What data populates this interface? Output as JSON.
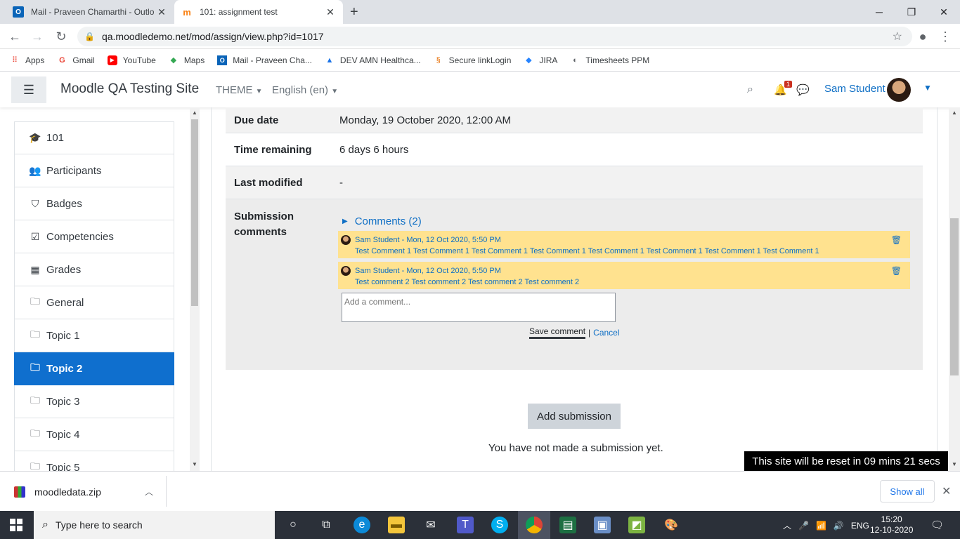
{
  "browser": {
    "tabs": [
      {
        "title": "Mail - Praveen Chamarthi - Outlo",
        "icon": "outlook-icon"
      },
      {
        "title": "101: assignment test",
        "icon": "moodle-icon"
      }
    ],
    "url": "qa.moodledemo.net/mod/assign/view.php?id=1017",
    "bookmarks": [
      {
        "label": "Apps",
        "icon": "apps-icon"
      },
      {
        "label": "Gmail",
        "icon": "google-icon"
      },
      {
        "label": "YouTube",
        "icon": "youtube-icon"
      },
      {
        "label": "Maps",
        "icon": "maps-icon"
      },
      {
        "label": "Mail - Praveen Cha...",
        "icon": "outlook-icon"
      },
      {
        "label": "DEV AMN Healthca...",
        "icon": "dev-icon"
      },
      {
        "label": "Secure linkLogin",
        "icon": "link-icon"
      },
      {
        "label": "JIRA",
        "icon": "jira-icon"
      },
      {
        "label": "Timesheets PPM",
        "icon": "timesheet-icon"
      }
    ]
  },
  "navbar": {
    "site_name": "Moodle QA Testing Site",
    "theme_label": "THEME",
    "language_label": "English (en)",
    "notification_count": "1",
    "user_name": "Sam Student"
  },
  "sidebar": {
    "items": [
      {
        "label": "101",
        "icon": "graduation-cap-icon"
      },
      {
        "label": "Participants",
        "icon": "users-icon"
      },
      {
        "label": "Badges",
        "icon": "shield-icon"
      },
      {
        "label": "Competencies",
        "icon": "check-square-icon"
      },
      {
        "label": "Grades",
        "icon": "table-icon"
      },
      {
        "label": "General",
        "icon": "folder-icon"
      },
      {
        "label": "Topic 1",
        "icon": "folder-icon"
      },
      {
        "label": "Topic 2",
        "icon": "folder-icon",
        "active": true
      },
      {
        "label": "Topic 3",
        "icon": "folder-icon"
      },
      {
        "label": "Topic 4",
        "icon": "folder-icon"
      },
      {
        "label": "Topic 5",
        "icon": "folder-icon"
      }
    ]
  },
  "status": {
    "due_date_label": "Due date",
    "due_date_value": "Monday, 19 October 2020, 12:00 AM",
    "time_remaining_label": "Time remaining",
    "time_remaining_value": "6 days 6 hours",
    "last_modified_label": "Last modified",
    "last_modified_value": "-",
    "submission_comments_label": "Submission comments"
  },
  "comments": {
    "header": "Comments (2)",
    "items": [
      {
        "meta": "Sam Student - Mon, 12 Oct 2020, 5:50 PM",
        "text": "Test Comment 1 Test Comment 1 Test Comment 1 Test Comment 1 Test Comment 1 Test Comment 1 Test Comment 1 Test Comment 1"
      },
      {
        "meta": "Sam Student - Mon, 12 Oct 2020, 5:50 PM",
        "text": "Test comment 2 Test comment 2 Test comment 2 Test comment 2"
      }
    ],
    "placeholder": "Add a comment...",
    "save_label": "Save comment",
    "separator": "|",
    "cancel_label": "Cancel"
  },
  "submission": {
    "button_label": "Add submission",
    "status_text": "You have not made a submission yet."
  },
  "reset_notice": "This site will be reset in 09 mins 21 secs",
  "download": {
    "file_name": "moodledata.zip",
    "show_all_label": "Show all"
  },
  "taskbar": {
    "search_placeholder": "Type here to search",
    "language": "ENG",
    "time": "15:20",
    "date": "12-10-2020"
  }
}
